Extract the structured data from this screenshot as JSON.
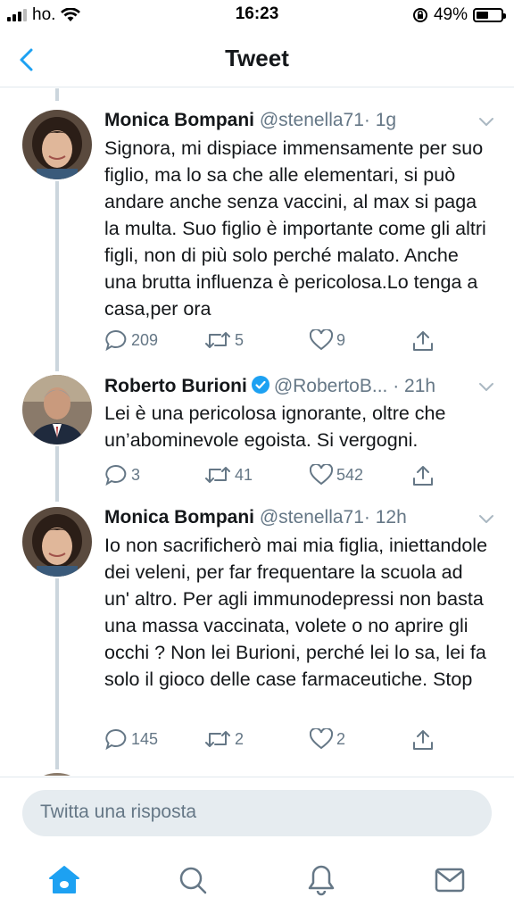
{
  "status_bar": {
    "carrier": "ho.",
    "time": "16:23",
    "battery": "49%",
    "battery_level": 0.49
  },
  "nav": {
    "title": "Tweet",
    "back_icon": "chevron-left-icon"
  },
  "tweets": [
    {
      "name": "Monica Bompani",
      "handle": "@stenella71",
      "time": "· 1g",
      "verified": false,
      "text": "Signora, mi dispiace immensamente per suo figlio, ma lo sa che alle elementari, si può andare anche senza vaccini, al max si paga la multa. Suo figlio è importante come gli altri figli, non di più solo perché malato. Anche una brutta influenza è pericolosa.Lo tenga a casa,per ora",
      "replies": "209",
      "retweets": "5",
      "likes": "9"
    },
    {
      "name": "Roberto Burioni",
      "handle": "@RobertoB...",
      "time": "· 21h",
      "verified": true,
      "text": "Lei è una pericolosa ignorante, oltre che un’abominevole egoista. Si vergogni.",
      "replies": "3",
      "retweets": "41",
      "likes": "542"
    },
    {
      "name": "Monica Bompani",
      "handle": "@stenella71",
      "time": "· 12h",
      "verified": false,
      "text": "Io non sacrificherò mai mia figlia, iniettandole dei veleni, per far frequentare la scuola ad un' altro. Per agli immunodepressi non basta una massa vaccinata, volete o no aprire gli occhi ? Non lei Burioni, perché lei lo sa, lei fa solo il gioco delle case farmaceutiche. Stop",
      "replies": "145",
      "retweets": "2",
      "likes": "2"
    }
  ],
  "reply": {
    "placeholder": "Twitta una risposta"
  },
  "tab_bar": {
    "icons": [
      "home-icon",
      "search-icon",
      "notifications-icon",
      "messages-icon"
    ]
  },
  "colors": {
    "accent": "#1da1f2",
    "text": "#14171a",
    "secondary": "#657786",
    "divider": "#e1e8ed",
    "thread_line": "#ccd6dd",
    "input_bg": "#e6ecf0"
  }
}
